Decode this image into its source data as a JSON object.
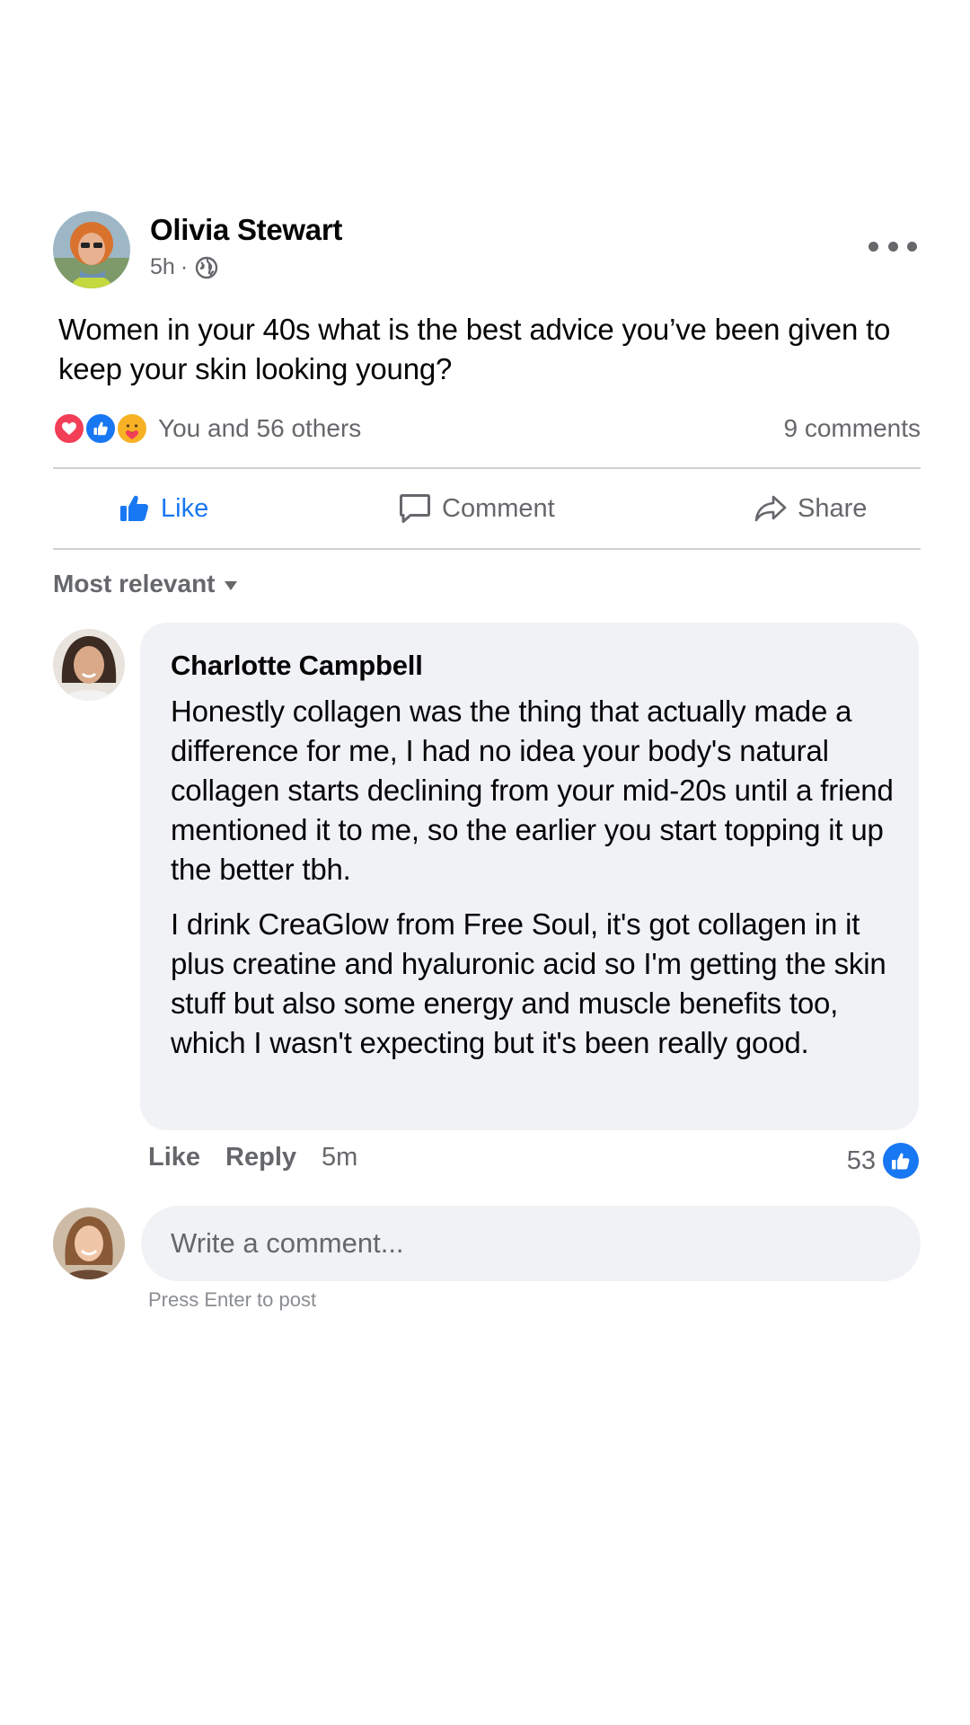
{
  "post": {
    "author": "Olivia Stewart",
    "time": "5h",
    "separator": "·",
    "text": "Women in your 40s what is the best advice you’ve been given to keep your skin looking young?",
    "reaction_summary": "You and 56 others",
    "comments_count": "9 comments"
  },
  "actions": {
    "like": "Like",
    "comment": "Comment",
    "share": "Share"
  },
  "sort": {
    "label": "Most relevant"
  },
  "comment": {
    "author": "Charlotte Campbell",
    "paragraph_1": "Honestly collagen was the thing that actually made a difference for me, I had no idea your body's natural collagen starts declining from your mid-20s until a friend mentioned it to me, so the earlier you start topping it up the better tbh.",
    "paragraph_2": "I drink CreaGlow from Free Soul, it's got collagen in it plus creatine and hyaluronic acid so I'm getting the skin stuff but also some energy and muscle benefits too, which I wasn't expecting but it's been really good.",
    "like_label": "Like",
    "reply_label": "Reply",
    "time": "5m",
    "reaction_count": "53"
  },
  "composer": {
    "placeholder": "Write a comment...",
    "hint": "Press Enter to post"
  },
  "colors": {
    "accent": "#1877f2",
    "love": "#f33e58",
    "care": "#f7b125",
    "secondary_text": "#65676b",
    "bubble": "#f0f2f5",
    "divider": "#ced0d4"
  },
  "icons": {
    "more": "more-dots-icon",
    "privacy": "globe-icon",
    "like": "thumbs-up-icon",
    "comment": "speech-bubble-icon",
    "share": "share-arrow-icon",
    "sort": "caret-down-icon"
  }
}
